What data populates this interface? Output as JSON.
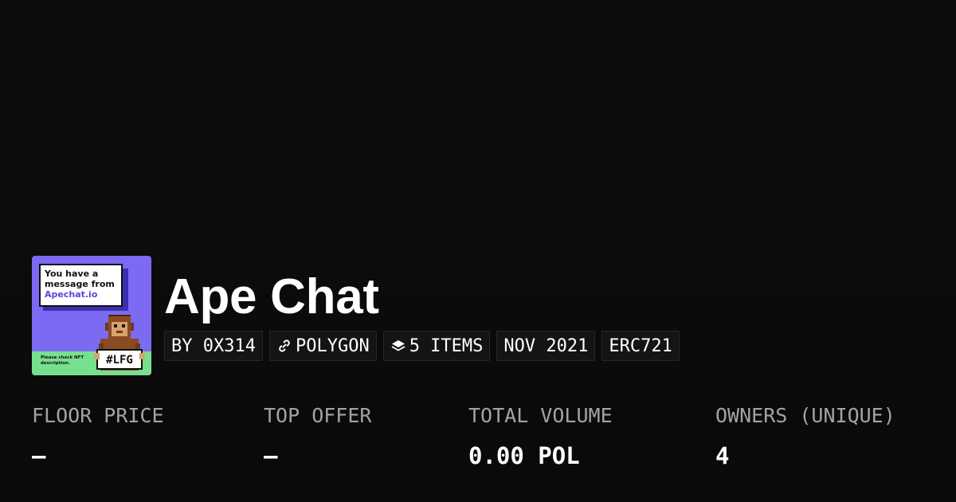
{
  "collection": {
    "name": "Ape Chat",
    "image": {
      "bubble_lines": [
        "You have a",
        "message from"
      ],
      "bubble_brand": "Apechat.io",
      "note": "Please check NFT description.",
      "sign_text": "#LFG",
      "colors": {
        "background": "#7c6af2",
        "band": "#77e08f",
        "brand": "#5a45e0"
      }
    }
  },
  "pills": [
    {
      "label": "BY 0X314",
      "icon": null
    },
    {
      "label": "POLYGON",
      "icon": "chain-link-icon"
    },
    {
      "label": "5 ITEMS",
      "icon": "layers-icon"
    },
    {
      "label": "NOV 2021",
      "icon": null
    },
    {
      "label": "ERC721",
      "icon": null
    }
  ],
  "stats": [
    {
      "label": "FLOOR PRICE",
      "value": "–"
    },
    {
      "label": "TOP OFFER",
      "value": "–"
    },
    {
      "label": "TOTAL VOLUME",
      "value": "0.00 POL"
    },
    {
      "label": "OWNERS (UNIQUE)",
      "value": "4"
    }
  ],
  "colors": {
    "background": "#0b0b0b",
    "text": "#ffffff",
    "muted_text": "#a3a3a3",
    "pill_background": "#141414",
    "pill_border": "#262626"
  }
}
